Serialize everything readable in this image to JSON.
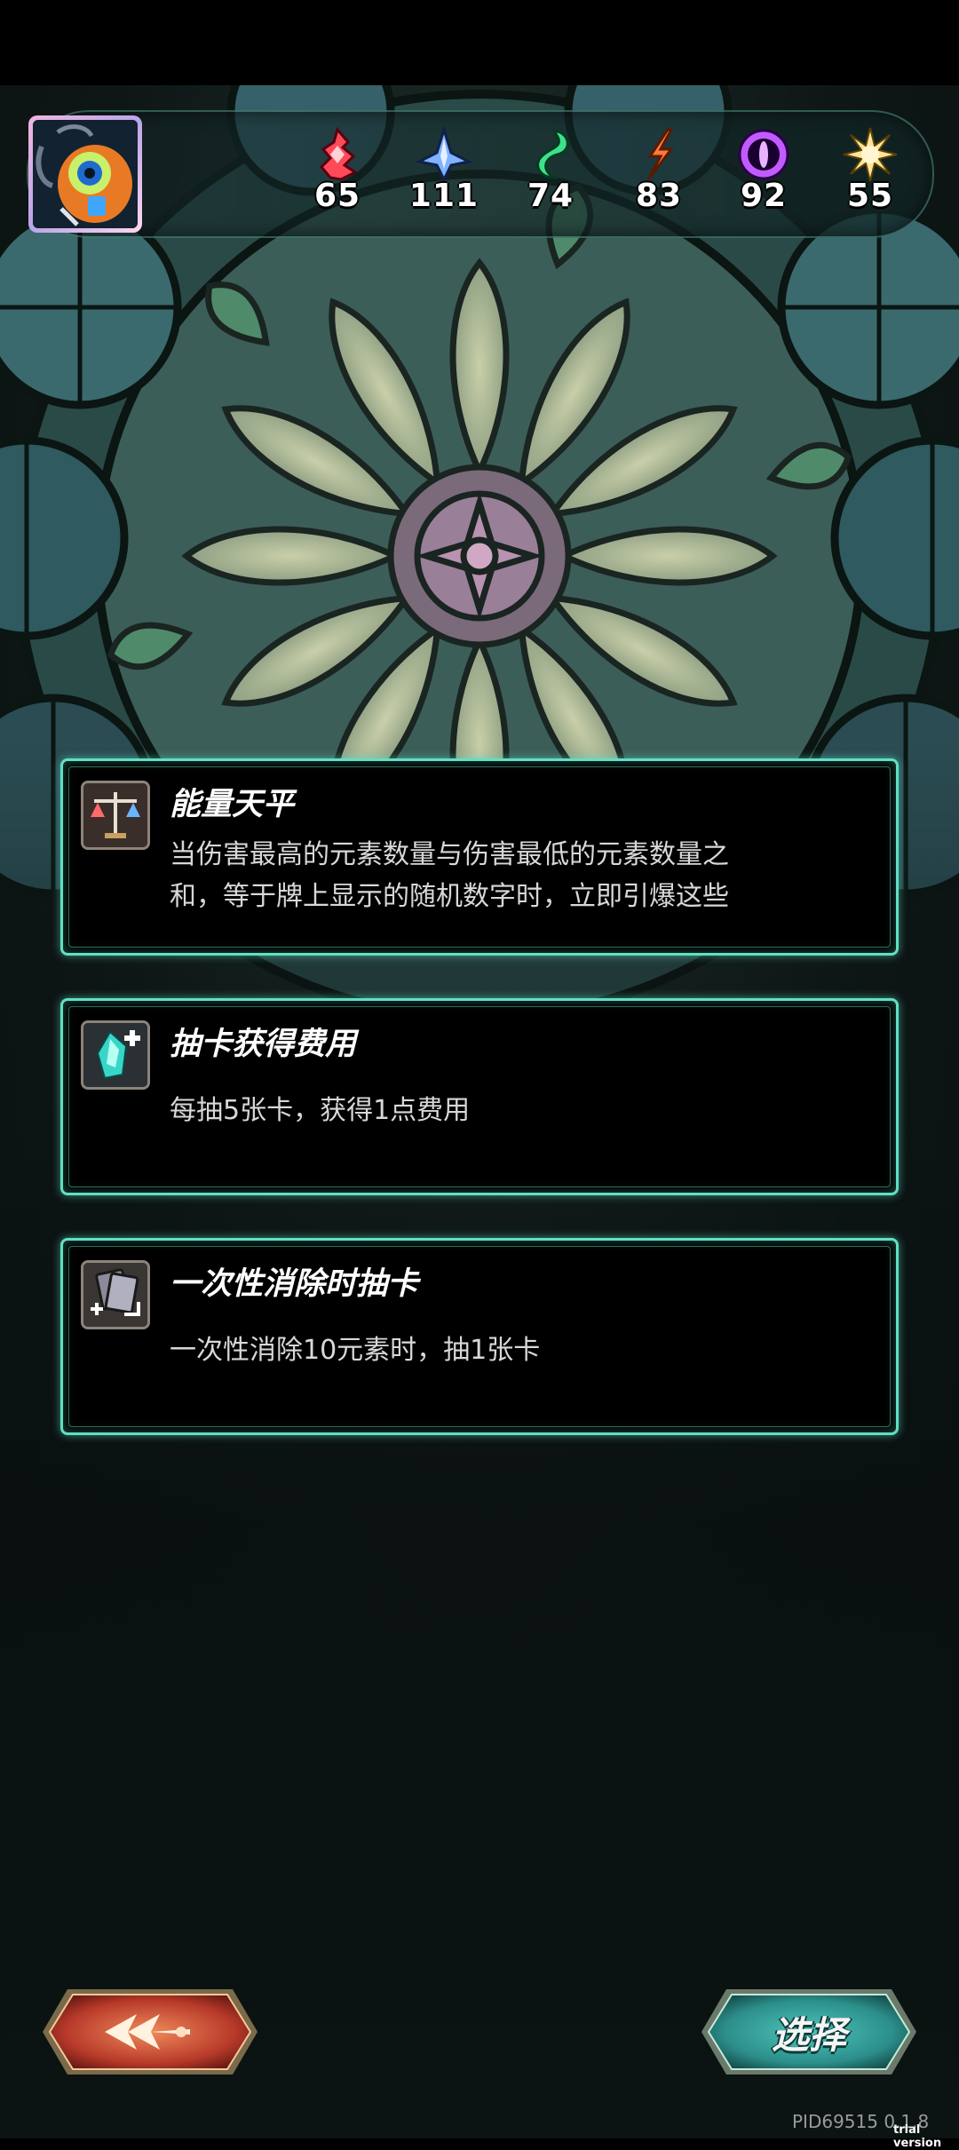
{
  "resources": [
    {
      "name": "fire",
      "icon": "fire-element-icon",
      "value": "65",
      "color": "#ff4a5a"
    },
    {
      "name": "ice",
      "icon": "ice-crystal-icon",
      "value": "111",
      "color": "#7fb2ff"
    },
    {
      "name": "wind",
      "icon": "wind-swirl-icon",
      "value": "74",
      "color": "#3ee08a"
    },
    {
      "name": "lightning",
      "icon": "lightning-bolt-icon",
      "value": "83",
      "color": "#ff7a3a"
    },
    {
      "name": "void",
      "icon": "void-eye-icon",
      "value": "92",
      "color": "#c25bff"
    },
    {
      "name": "light",
      "icon": "sun-icon",
      "value": "55",
      "color": "#ffe39a"
    }
  ],
  "cards": [
    {
      "title": "能量天平",
      "description": "当伤害最高的元素数量与伤害最低的元素数量之\n和，等于牌上显示的随机数字时，立即引爆这些",
      "icon": "balance-scale-icon"
    },
    {
      "title": "抽卡获得费用",
      "description": "每抽5张卡，获得1点费用",
      "icon": "crystal-plus-icon"
    },
    {
      "title": "一次性消除时抽卡",
      "description": "一次性消除10元素时，抽1张卡",
      "icon": "card-draw-icon"
    }
  ],
  "buttons": {
    "back_icon": "back-arrow-icon",
    "select_label": "选择"
  },
  "footer": {
    "version": "PID69515 0.1.8",
    "trial": "trial version"
  },
  "colors": {
    "card_border": "#5fe0c4",
    "back_button": "#c84a32",
    "select_button": "#2c8e8a"
  }
}
